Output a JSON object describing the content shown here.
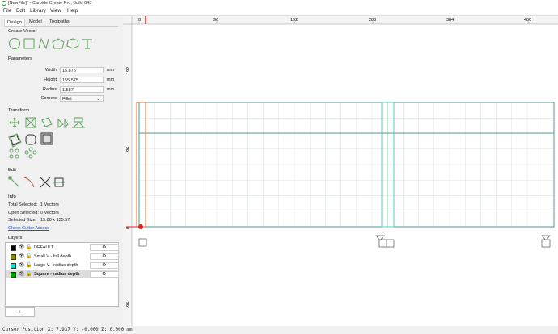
{
  "window": {
    "title": "[NewFile]* - Carbide Create Pro, Build 843"
  },
  "menu": [
    "File",
    "Edit",
    "Library",
    "View",
    "Help"
  ],
  "tabs": [
    "Design",
    "Model",
    "Toolpaths"
  ],
  "create_vector": {
    "label": "Create Vector",
    "tools": [
      "circle-tool-icon",
      "rectangle-tool-icon",
      "curve-tool-icon",
      "polygon-tool-icon",
      "star-tool-icon",
      "text-tool-icon"
    ]
  },
  "parameters": {
    "label": "Parameters",
    "width_label": "Width",
    "width_value": "15.875",
    "width_unit": "mm",
    "height_label": "Height",
    "height_value": "155.575",
    "height_unit": "mm",
    "radius_label": "Radius",
    "radius_value": "1.587",
    "radius_unit": "mm",
    "corners_label": "Corners",
    "corners_value": "Fillet"
  },
  "transform": {
    "label": "Transform"
  },
  "edit": {
    "label": "Edit"
  },
  "info": {
    "label": "Info",
    "total_selected_label": "Total Selected:",
    "total_selected_value": "1 Vectors",
    "open_selected_label": "Open Selected:",
    "open_selected_value": "0 Vectors",
    "selected_size_label": "Selected Size:",
    "selected_size_value": "15.88 x 155.57",
    "check_cutter_link": "Check Cutter Access"
  },
  "layers": {
    "label": "Layers",
    "items": [
      {
        "name": "DEFAULT",
        "color": "#000000",
        "selected": false
      },
      {
        "name": "Small V - full depth",
        "color": "#8b8b00",
        "selected": false
      },
      {
        "name": "Large V - radius depth",
        "color": "#00e0e0",
        "selected": false
      },
      {
        "name": "Square - radius depth",
        "color": "#00a000",
        "selected": true
      }
    ],
    "add_label": "+"
  },
  "ruler": {
    "top_ticks": [
      "0",
      "96",
      "192",
      "288",
      "384",
      "480"
    ],
    "left_ticks": [
      "192",
      "96",
      "0",
      "-96"
    ]
  },
  "status": {
    "cursor_text": "Cursor Position X: 7.937 Y: -0.000 Z: 0.000 mm"
  },
  "colors": {
    "accent_green": "#5aa05a",
    "grid_line": "#d8e0e0",
    "shape_outline": "#2f7f7f",
    "origin_red": "#e02020"
  }
}
